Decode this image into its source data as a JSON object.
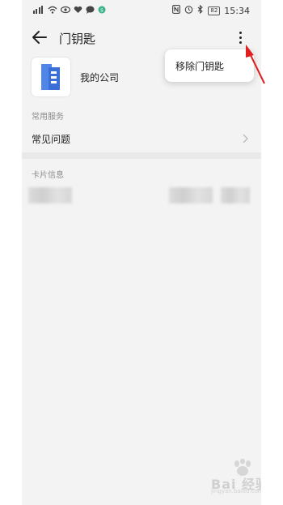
{
  "status_bar": {
    "left_icons": [
      "signal-icon",
      "wifi-icon",
      "eye-icon",
      "heart-icon",
      "message-icon",
      "alipay-icon"
    ],
    "right_icons": [
      "nfc-icon",
      "alarm-icon",
      "bluetooth-icon"
    ],
    "battery": "82",
    "time": "15:34"
  },
  "app_bar": {
    "title": "门钥匙",
    "back_icon": "back-arrow-icon",
    "more_icon": "more-vert-icon"
  },
  "card": {
    "company": "我的公司",
    "logo_color": "#3a6fd8"
  },
  "sections": {
    "common_services": "常用服务",
    "card_info": "卡片信息"
  },
  "faq": {
    "label": "常见问题"
  },
  "popup_menu": {
    "item": "移除门钥匙"
  },
  "annotation": {
    "arrow_color": "#e01f1f"
  },
  "watermark": {
    "text": "Bai 经验",
    "url": "jingyan.baidu.com"
  }
}
